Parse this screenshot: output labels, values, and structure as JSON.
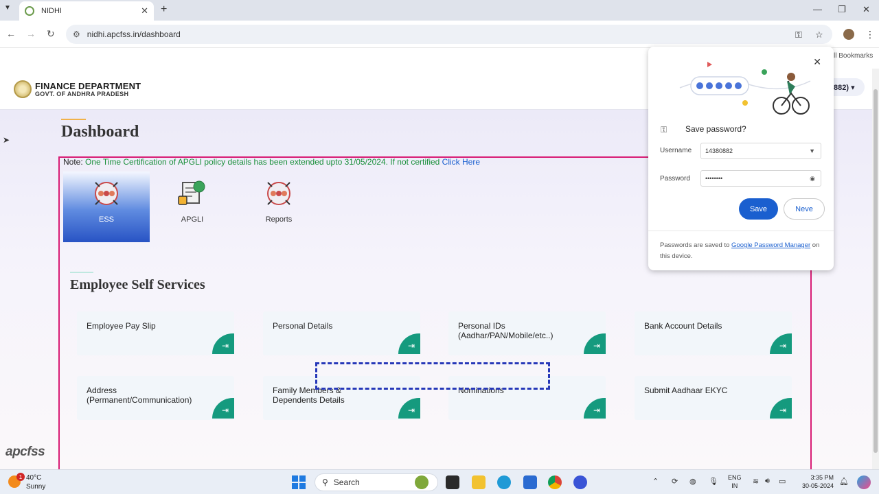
{
  "browser": {
    "tab_title": "NIDHI",
    "tab_close": "✕",
    "new_tab": "+",
    "url": "nidhi.apcfss.in/dashboard",
    "bookmarks_label": "ll Bookmarks",
    "icons": [
      "chevron-down-icon",
      "back-icon",
      "forward-icon",
      "reload-icon",
      "site-settings-icon",
      "password-key-icon",
      "bookmark-star-icon",
      "profile-icon",
      "menu-icon"
    ]
  },
  "header": {
    "org_line1": "FINANCE DEPARTMENT",
    "org_line2": "GOVT. OF ANDHRA PRADESH",
    "user_chip": "882) ▾"
  },
  "page": {
    "title": "Dashboard",
    "note_label": "Note: ",
    "note_text": "One Time Certification of APGLI policy details has been extended upto 31/05/2024. If not certified ",
    "note_link": "Click Here",
    "modules": [
      {
        "label": "ESS",
        "active": true
      },
      {
        "label": "APGLI",
        "active": false
      },
      {
        "label": "Reports",
        "active": false
      }
    ],
    "section_title": "Employee Self Services",
    "go_icon": "⇥",
    "cards": [
      {
        "label": "Employee Pay Slip"
      },
      {
        "label": "Personal Details"
      },
      {
        "label": "Personal IDs (Aadhar/PAN/Mobile/etc..)"
      },
      {
        "label": "Bank Account Details"
      },
      {
        "label": "Address (Permanent/Communication)"
      },
      {
        "label": "Family Members & Dependents Details"
      },
      {
        "label": "Nominations"
      },
      {
        "label": "Submit Aadhaar EKYC"
      }
    ],
    "footer_logo": "apcfss"
  },
  "password_popup": {
    "title": "Save password?",
    "username_label": "Username",
    "username_value": "14380882",
    "password_label": "Password",
    "password_value": "••••••••",
    "save_label": "Save",
    "never_label": "Neve",
    "footer_text": "Passwords are saved to ",
    "footer_link": "Google Password Manager",
    "footer_text2": " on this device.",
    "colors": {
      "accent": "#1a5fcf"
    }
  },
  "taskbar": {
    "weather_badge": "1",
    "weather_temp": "40°C",
    "weather_desc": "Sunny",
    "search_label": "Search",
    "lang_line1": "ENG",
    "lang_line2": "IN",
    "time": "3:35 PM",
    "date": "30-05-2024"
  },
  "colors": {
    "frame": "#d81b74",
    "card_button": "#159a7e",
    "note_text": "#1a8f3a",
    "link": "#1a5fcf",
    "dashed_box": "#2638b8"
  }
}
